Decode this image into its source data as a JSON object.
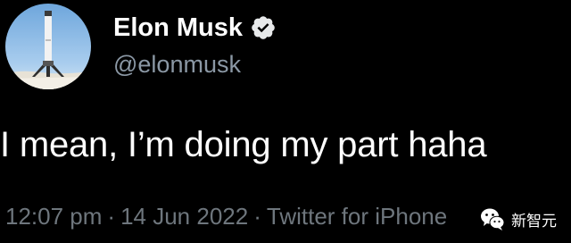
{
  "tweet": {
    "author": {
      "display_name": "Elon Musk",
      "handle": "@elonmusk",
      "verified": true,
      "avatar_icon": "rocket-booster-avatar"
    },
    "text": "I mean, I’m doing my part haha",
    "meta": {
      "time": "12:07 pm",
      "date": "14 Jun 2022",
      "source": "Twitter for iPhone"
    }
  },
  "watermark": {
    "text": "新智元",
    "icon": "wechat-logo-icon"
  },
  "colors": {
    "background": "#000000",
    "primary_text": "#ffffff",
    "secondary_text": "#8b98a5",
    "meta_text": "#6e767d",
    "verified_badge": "#e7e9ea"
  }
}
